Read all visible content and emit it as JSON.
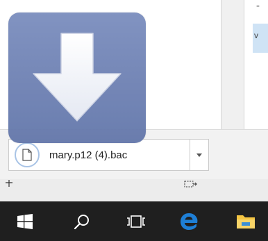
{
  "download_bar": {
    "filename": "mary.p12 (4).bac"
  },
  "icons": {
    "file": "file-icon",
    "dropdown": "chevron-down-icon",
    "overlay_arrow": "download-arrow-icon",
    "start": "windows-start-icon",
    "search": "search-icon",
    "task_view": "task-view-icon",
    "edge": "edge-browser-icon",
    "explorer": "file-explorer-icon"
  },
  "colors": {
    "overlay": "#6f82b4",
    "taskbar": "#1f1f1f",
    "edge_blue": "#1e7fd6",
    "folder_yellow": "#f4c542"
  }
}
